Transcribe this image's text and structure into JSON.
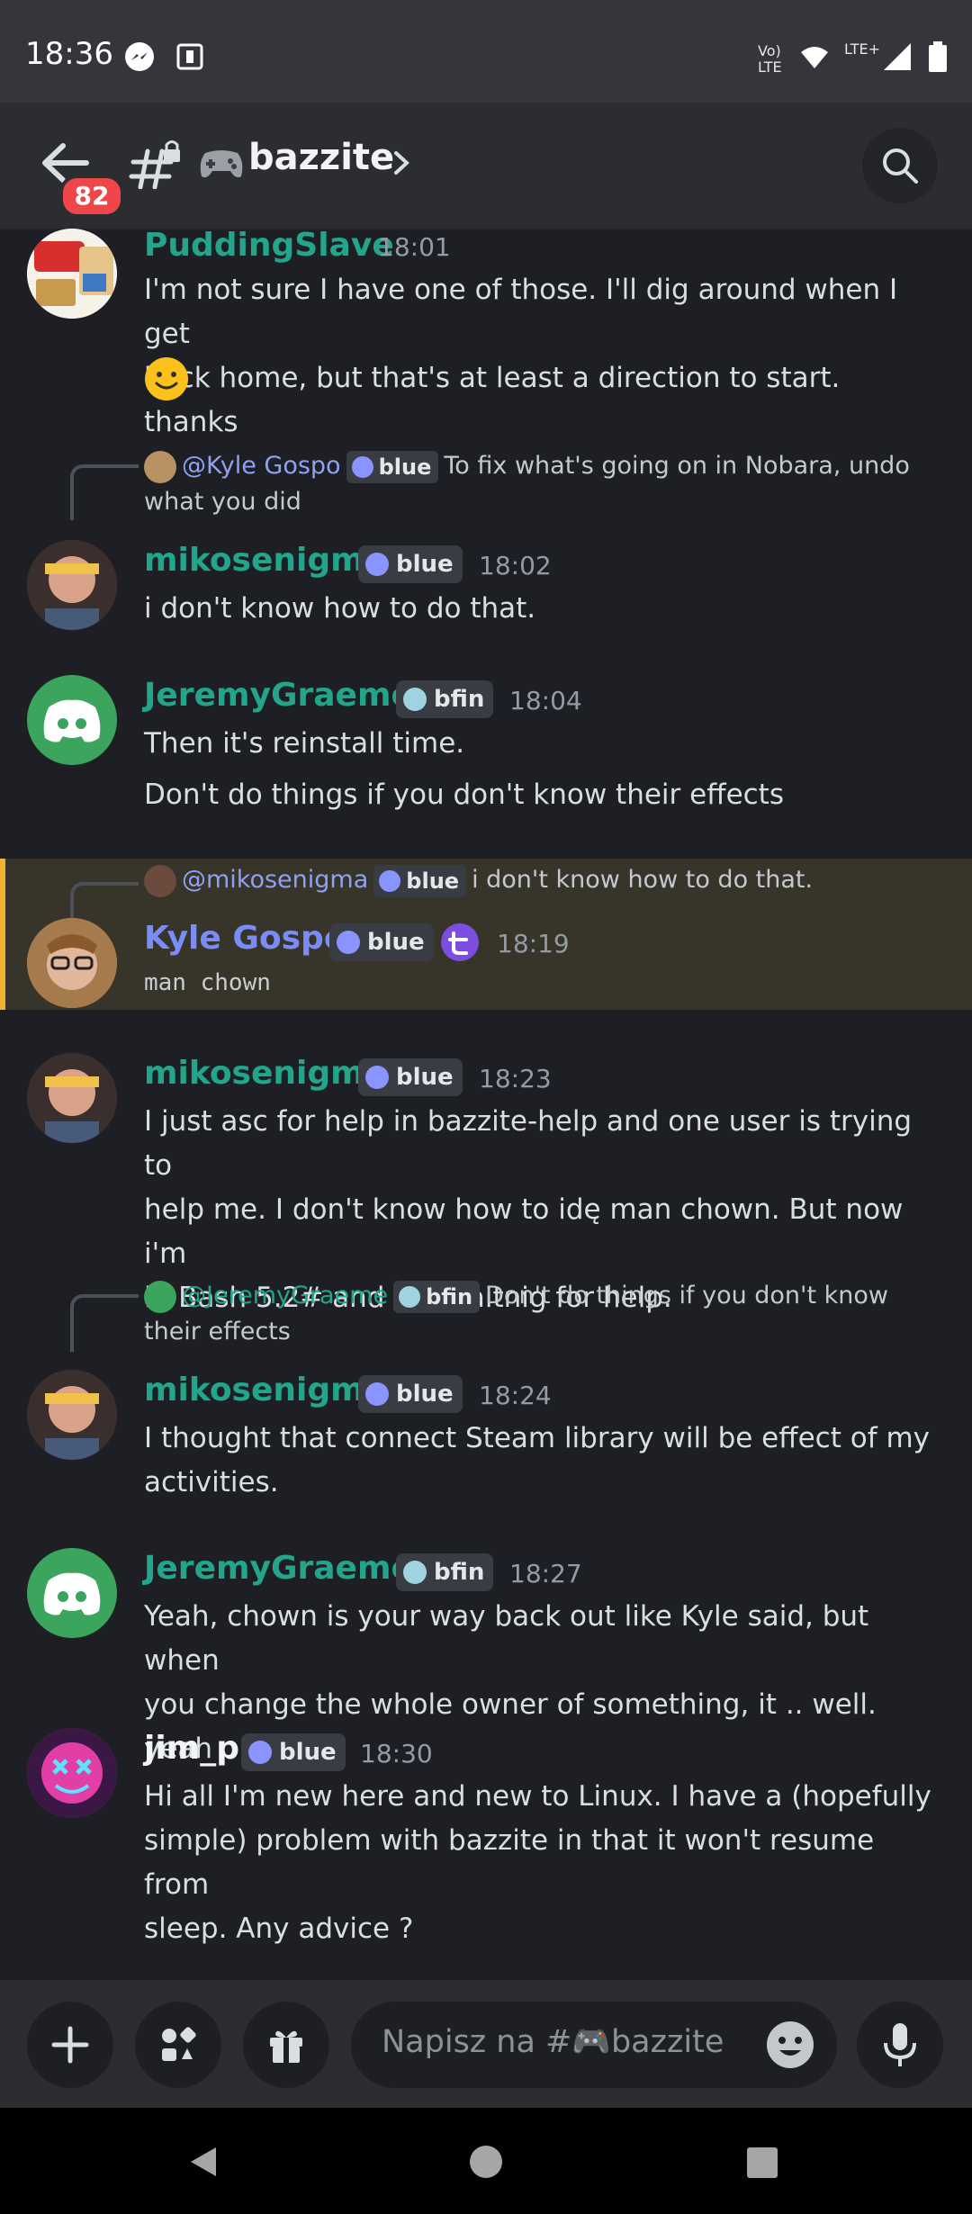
{
  "status_bar": {
    "time": "18:36",
    "lte_label": "Vo) LTE",
    "lte_plus": "LTE+"
  },
  "header": {
    "unread_count": "82",
    "channel_emoji": "🎮",
    "channel_name": "bazzite"
  },
  "messages": [
    {
      "author": "PuddingSlave",
      "author_color": "#23a58c",
      "time": "18:01",
      "lines": [
        "I'm not sure I have one of those. I'll dig around when I get",
        "back home, but that's at least a direction to start. thanks"
      ],
      "emoji": "🙂"
    },
    {
      "reply": {
        "mention": "@Kyle Gospo",
        "role": "blue",
        "text": "To fix what's going on in Nobara, undo",
        "text2": "what you did"
      },
      "author": "mikosenigma",
      "author_color": "#23a58c",
      "role": "blue",
      "time": "18:02",
      "lines": [
        "i don't know how to do that."
      ]
    },
    {
      "author": "JeremyGraeme",
      "author_color": "#23a58c",
      "role": "bfin",
      "time": "18:04",
      "lines": [
        "Then it's reinstall time.",
        "Don't do things if you don't know their effects"
      ]
    },
    {
      "reply": {
        "mention": "@mikosenigma",
        "role": "blue",
        "text": "i don't know how to do that."
      },
      "author": "Kyle Gospo",
      "author_color": "#7a8cf5",
      "role": "blue",
      "time": "18:19",
      "lines": [
        "man  chown"
      ]
    },
    {
      "author": "mikosenigma",
      "author_color": "#23a58c",
      "role": "blue",
      "time": "18:23",
      "lines": [
        "I just asc for help in  bazzite-help and one user is trying to",
        "help me. I don't know how to idę man chown. But now i'm",
        "in Bash 5.2# and i'm waitnig for help."
      ]
    },
    {
      "reply": {
        "mention": "@JeremyGraeme",
        "role": "bfin",
        "text": "Don't do things if you don't know",
        "text2": "their effects"
      },
      "author": "mikosenigma",
      "author_color": "#23a58c",
      "role": "blue",
      "time": "18:24",
      "lines": [
        "I thought that connect Steam library will be effect of my",
        "activities."
      ]
    },
    {
      "author": "JeremyGraeme",
      "author_color": "#23a58c",
      "role": "bfin",
      "time": "18:27",
      "lines": [
        "Yeah, chown is your way back out like Kyle said, but when",
        "you change the whole owner of something, it .. well. yeah"
      ]
    },
    {
      "author": "jim_p",
      "author_color": "#f2f3f5",
      "role": "blue",
      "time": "18:30",
      "lines": [
        "Hi all I'm new here and new to Linux. I have a (hopefully",
        "simple) problem with bazzite in that it won't resume from",
        "sleep. Any advice ?"
      ]
    }
  ],
  "composer": {
    "placeholder": "Napisz na #🎮bazzite"
  },
  "colors": {
    "accent": "#5865f2",
    "discord_green": "#3ba55d",
    "badge_red": "#ee4649"
  }
}
